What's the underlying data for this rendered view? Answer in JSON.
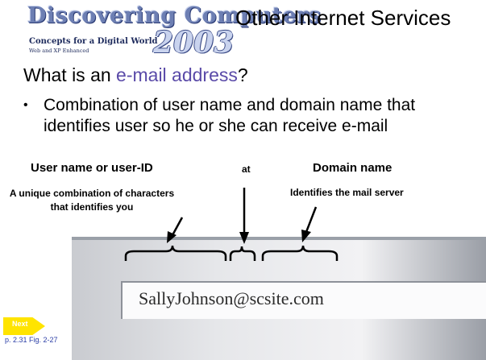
{
  "logo": {
    "title": "Discovering Computers",
    "subtitle": "Concepts for a Digital World",
    "subtitle2": "Web and XP Enhanced",
    "year": "2003"
  },
  "slide": {
    "title": "Other Internet Services",
    "question_prefix": "What is an ",
    "question_highlight": "e-mail address",
    "question_suffix": "?",
    "bullet_symbol": "•",
    "bullet": "Combination of user name and domain name that identifies user so he or she can receive e-mail"
  },
  "figure": {
    "user_label": "User name or user-ID",
    "at_label": "at",
    "domain_label": "Domain name",
    "user_desc": "A unique combination of characters that identifies you",
    "domain_desc": "Identifies the mail server",
    "email": "SallyJohnson@scsite.com"
  },
  "nav": {
    "next_label": "Next",
    "page_ref": "p. 2.31 Fig. 2-27"
  }
}
